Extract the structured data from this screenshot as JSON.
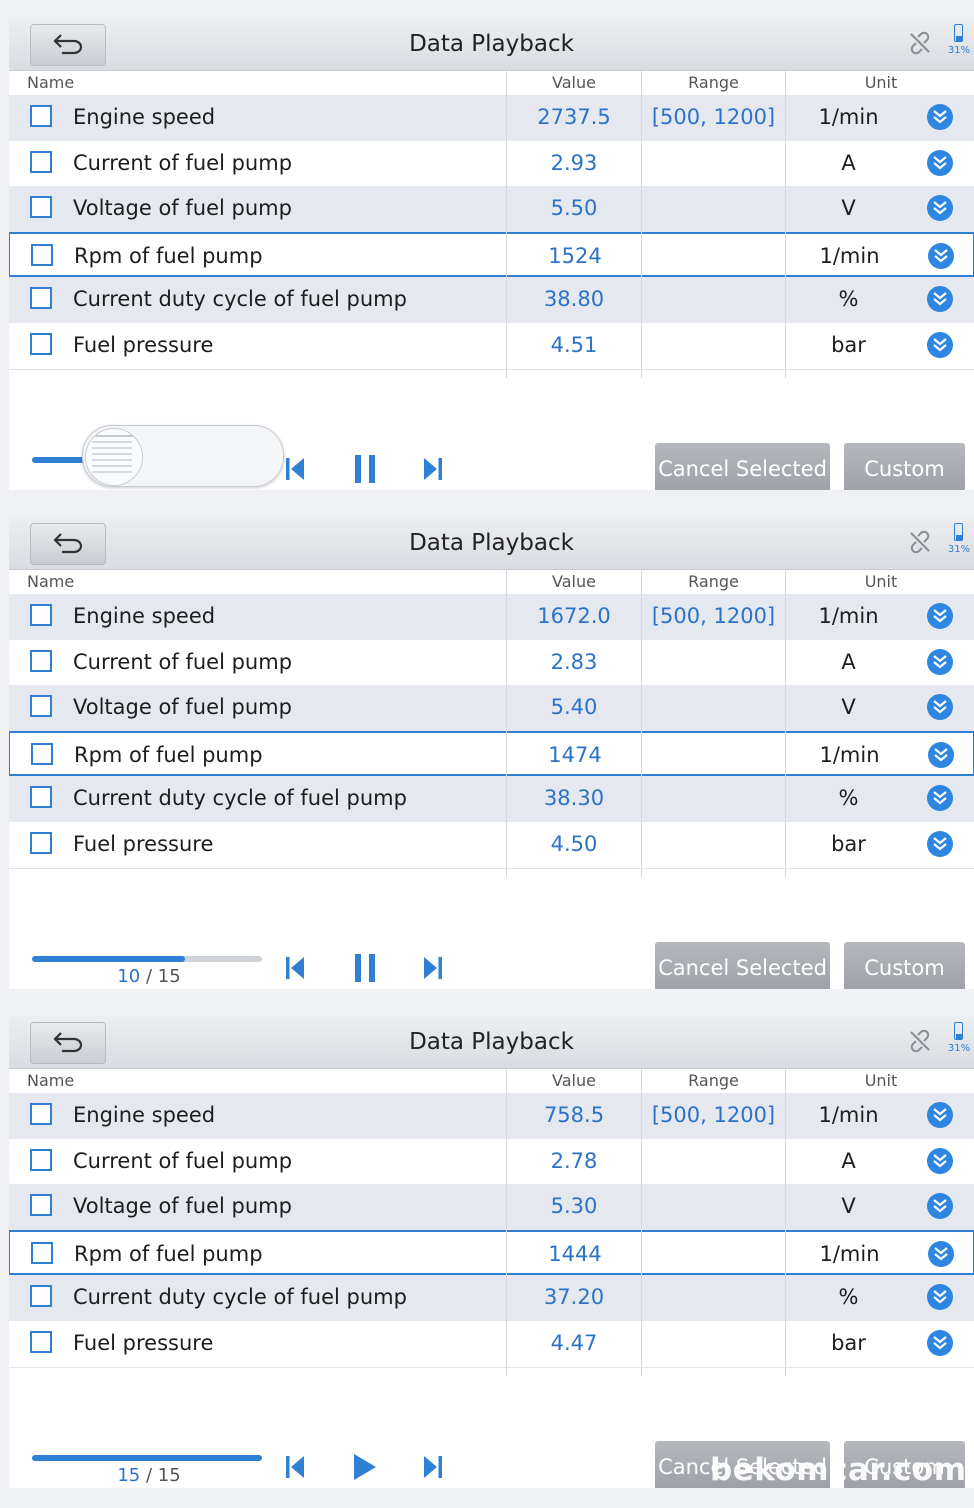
{
  "panels": [
    {
      "title": "Data Playback",
      "battery": "31%",
      "headers": {
        "name": "Name",
        "value": "Value",
        "range": "Range",
        "unit": "Unit"
      },
      "rows": [
        {
          "name": "Engine speed",
          "value": "2737.5",
          "range": "[500, 1200]",
          "unit": "1/min"
        },
        {
          "name": "Current of fuel pump",
          "value": "2.93",
          "range": "",
          "unit": "A"
        },
        {
          "name": "Voltage of fuel pump",
          "value": "5.50",
          "range": "",
          "unit": "V"
        },
        {
          "name": "Rpm of fuel pump",
          "value": "1524",
          "range": "",
          "unit": "1/min"
        },
        {
          "name": "Current duty cycle of fuel pump",
          "value": "38.80",
          "range": "",
          "unit": "%"
        },
        {
          "name": "Fuel pressure",
          "value": "4.51",
          "range": "",
          "unit": "bar"
        }
      ],
      "playback": {
        "current": "",
        "total": "",
        "progress": 0.35,
        "state": "playing"
      },
      "buttons": {
        "cancel": "Cancel Selected",
        "custom": "Custom"
      }
    },
    {
      "title": "Data Playback",
      "battery": "31%",
      "headers": {
        "name": "Name",
        "value": "Value",
        "range": "Range",
        "unit": "Unit"
      },
      "rows": [
        {
          "name": "Engine speed",
          "value": "1672.0",
          "range": "[500, 1200]",
          "unit": "1/min"
        },
        {
          "name": "Current of fuel pump",
          "value": "2.83",
          "range": "",
          "unit": "A"
        },
        {
          "name": "Voltage of fuel pump",
          "value": "5.40",
          "range": "",
          "unit": "V"
        },
        {
          "name": "Rpm of fuel pump",
          "value": "1474",
          "range": "",
          "unit": "1/min"
        },
        {
          "name": "Current duty cycle of fuel pump",
          "value": "38.30",
          "range": "",
          "unit": "%"
        },
        {
          "name": "Fuel pressure",
          "value": "4.50",
          "range": "",
          "unit": "bar"
        }
      ],
      "playback": {
        "current": "10",
        "total": "/ 15",
        "progress": 0.667,
        "state": "playing"
      },
      "buttons": {
        "cancel": "Cancel Selected",
        "custom": "Custom"
      }
    },
    {
      "title": "Data Playback",
      "battery": "31%",
      "headers": {
        "name": "Name",
        "value": "Value",
        "range": "Range",
        "unit": "Unit"
      },
      "rows": [
        {
          "name": "Engine speed",
          "value": "758.5",
          "range": "[500, 1200]",
          "unit": "1/min"
        },
        {
          "name": "Current of fuel pump",
          "value": "2.78",
          "range": "",
          "unit": "A"
        },
        {
          "name": "Voltage of fuel pump",
          "value": "5.30",
          "range": "",
          "unit": "V"
        },
        {
          "name": "Rpm of fuel pump",
          "value": "1444",
          "range": "",
          "unit": "1/min"
        },
        {
          "name": "Current duty cycle of fuel pump",
          "value": "37.20",
          "range": "",
          "unit": "%"
        },
        {
          "name": "Fuel pressure",
          "value": "4.47",
          "range": "",
          "unit": "bar"
        }
      ],
      "playback": {
        "current": "15",
        "total": "/ 15",
        "progress": 1.0,
        "state": "paused"
      },
      "buttons": {
        "cancel": "Cancel Selected",
        "custom": "Custom"
      }
    }
  ],
  "watermark": "bekomcar.com",
  "colors": {
    "accent": "#2f7fd4",
    "value_text": "#2a73c9",
    "row_shade": "#e5e8ee",
    "button_gray": "#a9adb3"
  }
}
